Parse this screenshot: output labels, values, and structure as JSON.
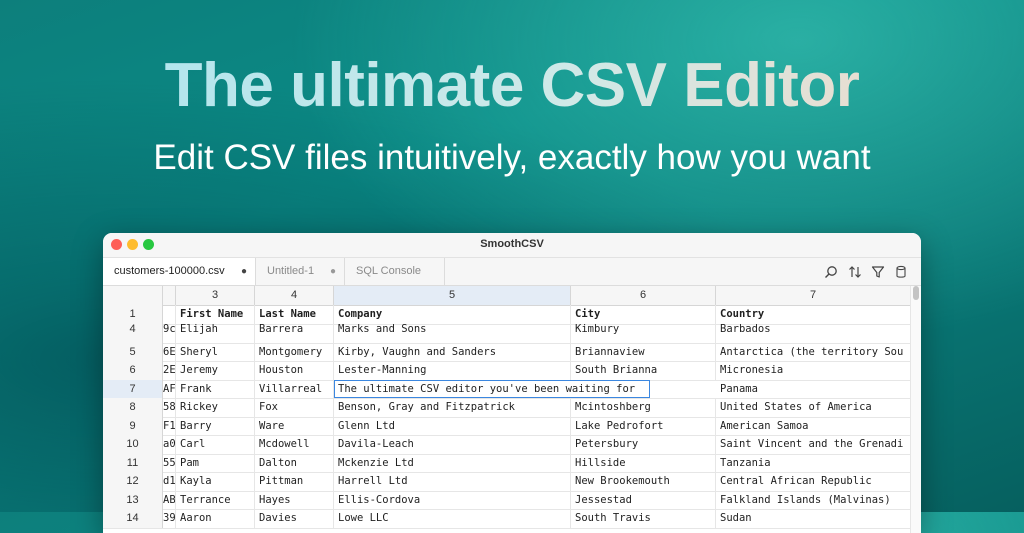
{
  "hero": {
    "title": "The ultimate CSV Editor",
    "subtitle": "Edit CSV files intuitively, exactly how you want"
  },
  "window": {
    "title": "SmoothCSV",
    "tabs": [
      {
        "label": "customers-100000.csv",
        "modified": "●"
      },
      {
        "label": "Untitled-1",
        "modified": "●"
      },
      {
        "label": "SQL Console",
        "modified": ""
      }
    ],
    "toolbar_icons": [
      "search-icon",
      "sort-icon",
      "filter-icon",
      "database-icon"
    ]
  },
  "grid": {
    "column_numbers": [
      "3",
      "4",
      "5",
      "6",
      "7"
    ],
    "selected_column": "5",
    "header": {
      "row": "1",
      "clip": "",
      "cells": [
        "First Name",
        "Last Name",
        "Company",
        "City",
        "Country"
      ]
    },
    "rows": [
      {
        "row": "4",
        "clip": "9c",
        "cells": [
          "Elijah",
          "Barrera",
          "Marks and Sons",
          "Kimbury",
          "Barbados"
        ]
      },
      {
        "row": "5",
        "clip": "6E",
        "cells": [
          "Sheryl",
          "Montgomery",
          "Kirby, Vaughn and Sanders",
          "Briannaview",
          "Antarctica (the territory Sou"
        ]
      },
      {
        "row": "6",
        "clip": "2E",
        "cells": [
          "Jeremy",
          "Houston",
          "Lester-Manning",
          "South Brianna",
          "Micronesia"
        ]
      },
      {
        "row": "7",
        "clip": "AF",
        "cells": [
          "Frank",
          "Villarreal",
          "The ultimate CSV editor you've been waiting for",
          "",
          "Panama"
        ]
      },
      {
        "row": "8",
        "clip": "58",
        "cells": [
          "Rickey",
          "Fox",
          "Benson, Gray and Fitzpatrick",
          "Mcintoshberg",
          "United States of America"
        ]
      },
      {
        "row": "9",
        "clip": "F1",
        "cells": [
          "Barry",
          "Ware",
          "Glenn Ltd",
          "Lake Pedrofort",
          "American Samoa"
        ]
      },
      {
        "row": "10",
        "clip": "a0",
        "cells": [
          "Carl",
          "Mcdowell",
          "Davila-Leach",
          "Petersbury",
          "Saint Vincent and the Grenadi"
        ]
      },
      {
        "row": "11",
        "clip": "55",
        "cells": [
          "Pam",
          "Dalton",
          "Mckenzie Ltd",
          "Hillside",
          "Tanzania"
        ]
      },
      {
        "row": "12",
        "clip": "d1",
        "cells": [
          "Kayla",
          "Pittman",
          "Harrell Ltd",
          "New Brookemouth",
          "Central African Republic"
        ]
      },
      {
        "row": "13",
        "clip": "AB",
        "cells": [
          "Terrance",
          "Hayes",
          "Ellis-Cordova",
          "Jessestad",
          "Falkland Islands (Malvinas)"
        ]
      },
      {
        "row": "14",
        "clip": "39",
        "cells": [
          "Aaron",
          "Davies",
          "Lowe LLC",
          "South Travis",
          "Sudan"
        ]
      }
    ],
    "selected_row": "7",
    "editing_value": "The ultimate CSV editor you've been waiting for"
  },
  "colors": {
    "accent": "#3b87e0",
    "selection": "#e4ecf6",
    "background_teal": "#0a8b86"
  }
}
